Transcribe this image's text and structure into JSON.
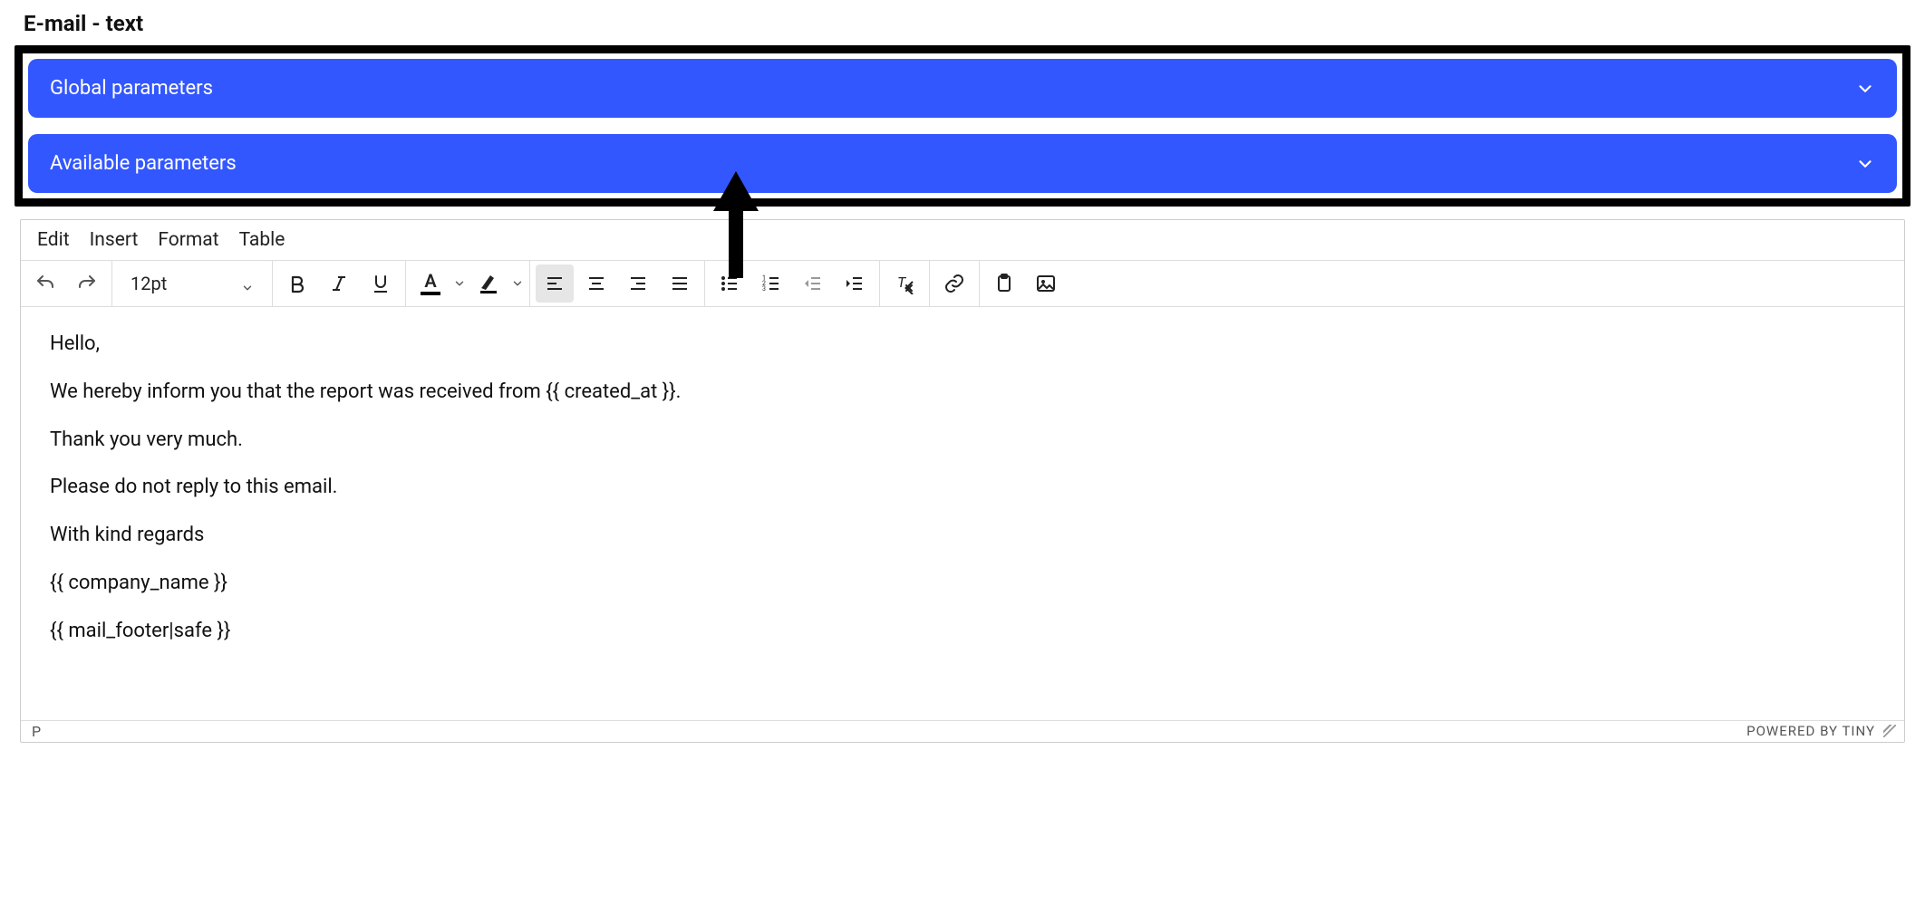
{
  "title": "E-mail - text",
  "accordions": {
    "global": "Global parameters",
    "available": "Available parameters"
  },
  "menu": {
    "edit": "Edit",
    "insert": "Insert",
    "format": "Format",
    "table": "Table"
  },
  "toolbar": {
    "font_size": "12pt",
    "text_color_letter": "A"
  },
  "content": {
    "p1": "Hello,",
    "p2": "We hereby inform you that the report was received from {{ created_at }}.",
    "p3": "Thank you very much.",
    "p4": "Please do not reply to this email.",
    "p5": "With kind regards",
    "p6": "{{ company_name }}",
    "p7": "{{ mail_footer|safe }}"
  },
  "status": {
    "path": "P",
    "powered": "POWERED BY TINY"
  }
}
